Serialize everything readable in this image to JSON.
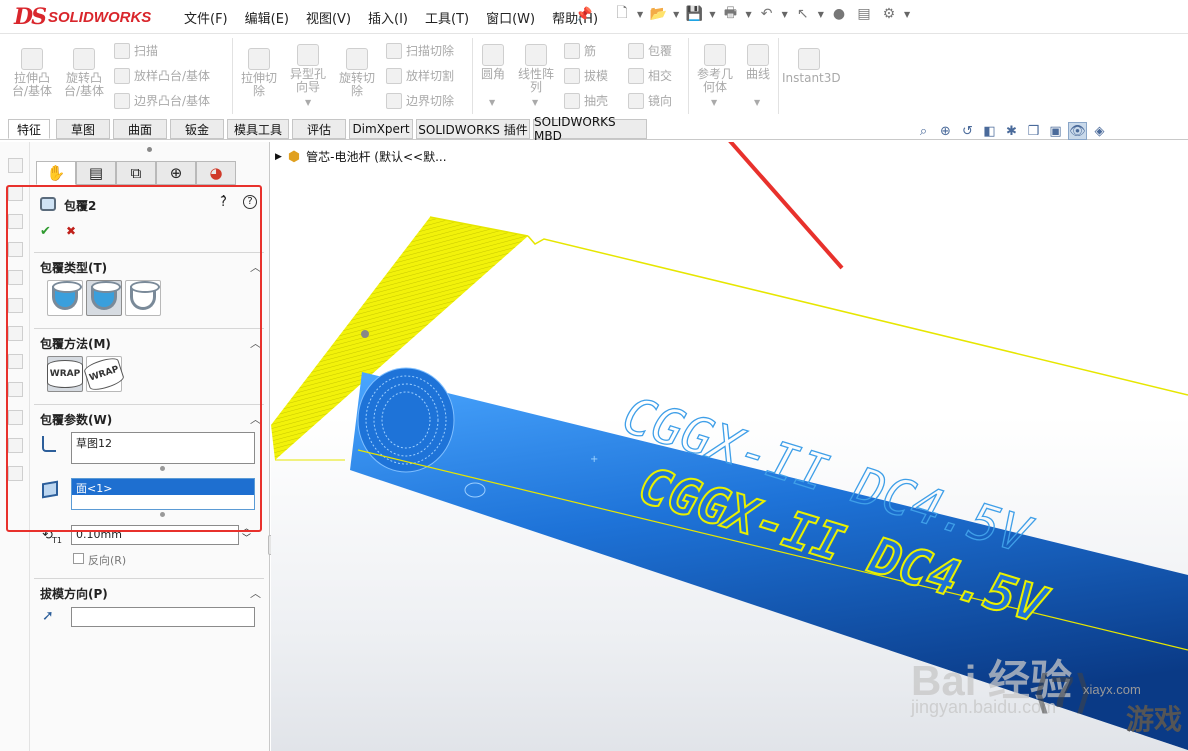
{
  "app": {
    "logo_ds": "DS",
    "logo_name": "SOLIDWORKS"
  },
  "menu": [
    "文件(F)",
    "编辑(E)",
    "视图(V)",
    "插入(I)",
    "工具(T)",
    "窗口(W)",
    "帮助(H)"
  ],
  "ribbon": {
    "extrude_boss": "拉伸凸\n台/基体",
    "revolve_boss": "旋转凸\n台/基体",
    "sweep": "扫描",
    "loft_boss": "放样凸台/基体",
    "boundary_boss": "边界凸台/基体",
    "extrude_cut": "拉伸切\n除",
    "hole_wizard": "异型孔\n向导",
    "revolve_cut": "旋转切\n除",
    "sweep_cut": "扫描切除",
    "loft_cut": "放样切割",
    "boundary_cut": "边界切除",
    "fillet": "圆角",
    "linear_pattern": "线性阵\n列",
    "rib": "筋",
    "draft": "拔模",
    "shell": "抽壳",
    "wrap": "包覆",
    "intersect": "相交",
    "mirror": "镜向",
    "ref_geometry": "参考几\n何体",
    "curves": "曲线",
    "instant3d": "Instant3D"
  },
  "tabs": [
    "特征",
    "草图",
    "曲面",
    "钣金",
    "模具工具",
    "评估",
    "DimXpert",
    "SOLIDWORKS 插件",
    "SOLIDWORKS MBD"
  ],
  "tree": {
    "part_name": "管芯-电池杆 (默认<<默..."
  },
  "property_manager": {
    "title": "包覆2",
    "ok": "✔",
    "cancel": "✖",
    "wrap_type_title": "包覆类型(T)",
    "wrap_method_title": "包覆方法(M)",
    "wrap_method_labels": [
      "WRAP",
      "WRAP"
    ],
    "wrap_params_title": "包覆参数(W)",
    "sketch_value": "草图12",
    "face_value": "面<1>",
    "thickness_value": "0.10mm",
    "thickness_label": "T1",
    "reverse_label": "反向(R)",
    "pull_dir_title": "拔模方向(P)"
  },
  "viewport": {
    "text_outline": "CGGX-II  DC4.5V",
    "text_filled": "CGGX-II  DC4.5V"
  },
  "watermark": {
    "baidu": "Bai 经验",
    "jingyan": "jingyan.baidu.com",
    "site": "xiayx.com",
    "game": "游戏"
  },
  "colors": {
    "accent_red": "#e8312c",
    "cylinder_blue": "#1e73d8",
    "sketch_yellow": "#f2f20a"
  }
}
